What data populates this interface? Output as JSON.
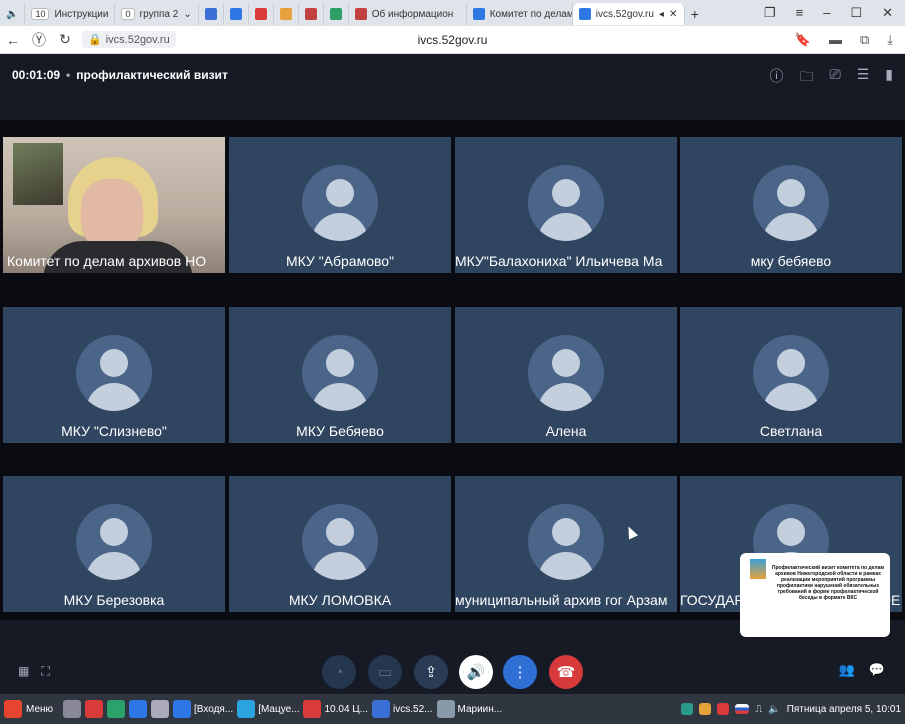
{
  "browser": {
    "tabs": [
      {
        "badge": "10",
        "label": "Инструкции",
        "color": "#555"
      },
      {
        "badge": "0",
        "label": "группа 2",
        "color": "#555"
      },
      {
        "label": "",
        "color": "#3b6fd6"
      },
      {
        "label": "",
        "color": "#2e78e6"
      },
      {
        "label": "",
        "color": "#d93b3b"
      },
      {
        "label": "",
        "color": "#e6a23b"
      },
      {
        "label": "",
        "color": "#c24040"
      },
      {
        "label": "",
        "color": "#2ea06a"
      },
      {
        "label": "Об информацион",
        "color": "#c24040"
      },
      {
        "label": "Комитет по делам",
        "color": "#2e78e6"
      },
      {
        "label": "ivcs.52gov.ru",
        "color": "#2e78e6",
        "active": true
      }
    ],
    "url_short": "ivcs.52gov.ru",
    "url_title": "ivcs.52gov.ru"
  },
  "meeting": {
    "timer": "00:01:09",
    "title": "профилактический визит"
  },
  "participants": [
    {
      "name": "Комитет по делам архивов НО",
      "video": true
    },
    {
      "name": "МКУ \"Абрамово\""
    },
    {
      "name": "МКУ\"Балахониха\" Ильичева Ма"
    },
    {
      "name": "мку бебяево"
    },
    {
      "name": "МКУ \"Слизнево\""
    },
    {
      "name": "МКУ Бебяево"
    },
    {
      "name": "Алена"
    },
    {
      "name": "Светлана"
    },
    {
      "name": "МКУ Березовка"
    },
    {
      "name": "МКУ ЛОМОВКА"
    },
    {
      "name": "муниципальный архив гог Арзам"
    },
    {
      "name": "ГОСУДАРСТВЕННОЕ КАЗЕННОЕ УЧРЕЖДЕНИЕ НО"
    }
  ],
  "slide_preview": {
    "title": "Профилактический визит комитета по делам архивов Нижегородской области в рамках реализации мероприятий программы профилактики нарушений обязательных требований в форме профилактической беседы в формате ВКС"
  },
  "taskbar": {
    "menu_label": "Меню",
    "items": [
      {
        "label": "[Входя...",
        "color": "#2e78e6"
      },
      {
        "label": "[Мацуе...",
        "color": "#2aa3de"
      },
      {
        "label": "10.04 Ц...",
        "color": "#d93b3b"
      },
      {
        "label": "ivcs.52...",
        "color": "#3b6fd6"
      },
      {
        "label": "Мариин...",
        "color": "#8899aa"
      }
    ],
    "clock": "Пятница апреля  5, 10:01"
  },
  "colors": {
    "end_call": "#d63a3a",
    "mic_active": "#ffffff",
    "more": "#2f6fd6"
  }
}
